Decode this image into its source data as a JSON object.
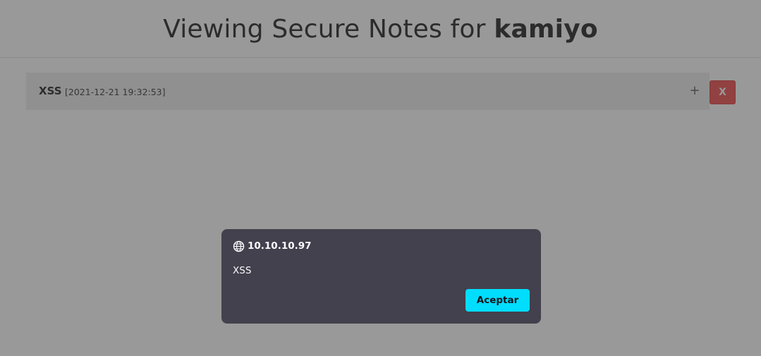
{
  "header": {
    "title_prefix": "Viewing Secure Notes for ",
    "username": "kamiyo"
  },
  "notes": [
    {
      "title": "XSS",
      "timestamp": "[2021-12-21 19:32:53]",
      "expand_label": "+",
      "delete_label": "X"
    }
  ],
  "dialog": {
    "origin_icon": "globe-icon",
    "host": "10.10.10.97",
    "message": "XSS",
    "ok_label": "Aceptar"
  },
  "colors": {
    "delete_button": "#f26d6d",
    "dialog_background": "#42414d",
    "dialog_button": "#00ddff",
    "overlay": "rgba(0,0,0,0.40)"
  }
}
